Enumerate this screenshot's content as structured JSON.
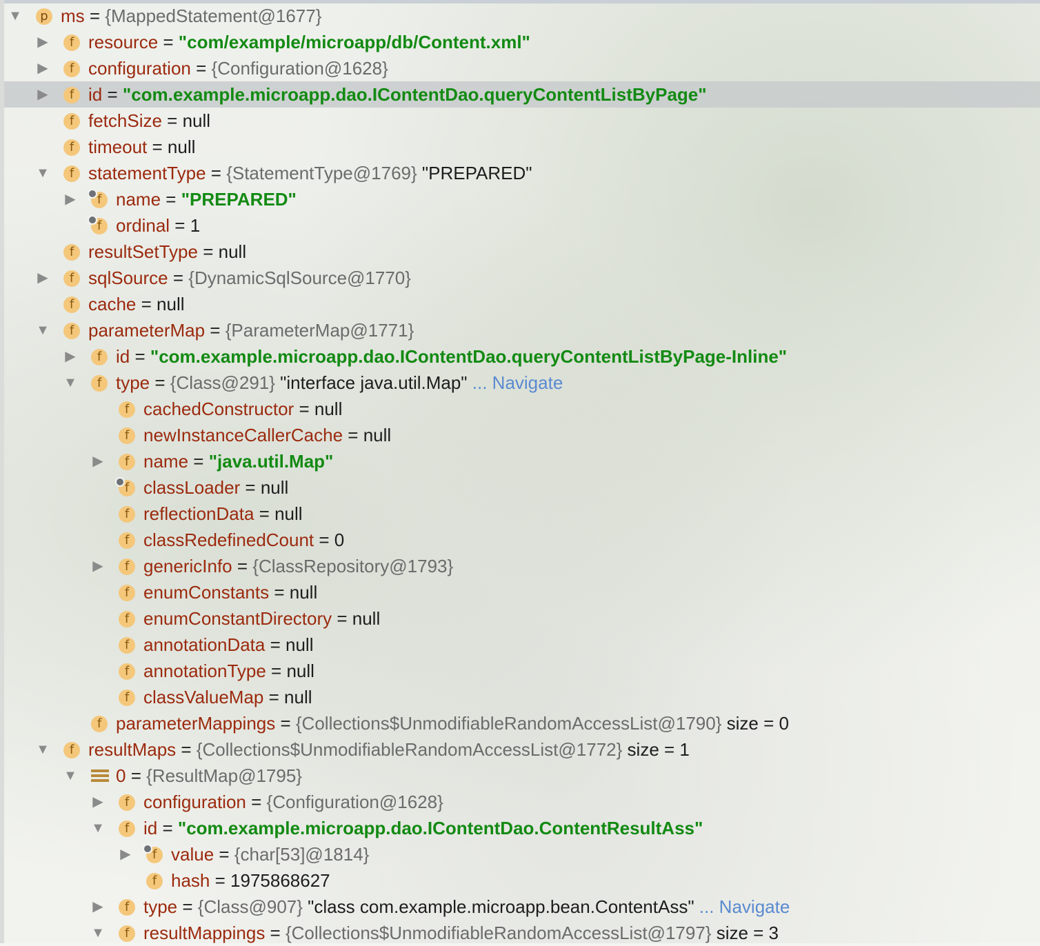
{
  "rows": [
    {
      "depth": 0,
      "arrow": "down",
      "icon": "p",
      "name": "ms",
      "eq": " = ",
      "ref": "{MappedStatement@1677}"
    },
    {
      "depth": 1,
      "arrow": "right",
      "icon": "f",
      "name": "resource",
      "eq": " = ",
      "str": "\"com/example/microapp/db/Content.xml\""
    },
    {
      "depth": 1,
      "arrow": "right",
      "icon": "f",
      "name": "configuration",
      "eq": " = ",
      "ref": "{Configuration@1628}"
    },
    {
      "depth": 1,
      "arrow": "right",
      "icon": "f",
      "name": "id",
      "eq": " = ",
      "str": "\"com.example.microapp.dao.IContentDao.queryContentListByPage\"",
      "selected": true
    },
    {
      "depth": 1,
      "arrow": "none",
      "icon": "f",
      "name": "fetchSize",
      "eq": " = ",
      "plain": "null"
    },
    {
      "depth": 1,
      "arrow": "none",
      "icon": "f",
      "name": "timeout",
      "eq": " = ",
      "plain": "null"
    },
    {
      "depth": 1,
      "arrow": "down",
      "icon": "f",
      "name": "statementType",
      "eq": " = ",
      "ref": "{StatementType@1769}",
      "plain": " \"PREPARED\""
    },
    {
      "depth": 2,
      "arrow": "right",
      "icon": "f-pin",
      "name": "name",
      "eq": " = ",
      "str": "\"PREPARED\""
    },
    {
      "depth": 2,
      "arrow": "none",
      "icon": "f-pin",
      "name": "ordinal",
      "eq": " = ",
      "plain": "1"
    },
    {
      "depth": 1,
      "arrow": "none",
      "icon": "f",
      "name": "resultSetType",
      "eq": " = ",
      "plain": "null"
    },
    {
      "depth": 1,
      "arrow": "right",
      "icon": "f",
      "name": "sqlSource",
      "eq": " = ",
      "ref": "{DynamicSqlSource@1770}"
    },
    {
      "depth": 1,
      "arrow": "none",
      "icon": "f",
      "name": "cache",
      "eq": " = ",
      "plain": "null"
    },
    {
      "depth": 1,
      "arrow": "down",
      "icon": "f",
      "name": "parameterMap",
      "eq": " = ",
      "ref": "{ParameterMap@1771}"
    },
    {
      "depth": 2,
      "arrow": "right",
      "icon": "f",
      "name": "id",
      "eq": " = ",
      "str": "\"com.example.microapp.dao.IContentDao.queryContentListByPage-Inline\""
    },
    {
      "depth": 2,
      "arrow": "down",
      "icon": "f",
      "name": "type",
      "eq": " = ",
      "ref": "{Class@291}",
      "plain": " \"interface java.util.Map\"",
      "nav": " ... Navigate"
    },
    {
      "depth": 3,
      "arrow": "none",
      "icon": "f",
      "name": "cachedConstructor",
      "eq": " = ",
      "plain": "null"
    },
    {
      "depth": 3,
      "arrow": "none",
      "icon": "f",
      "name": "newInstanceCallerCache",
      "eq": " = ",
      "plain": "null"
    },
    {
      "depth": 3,
      "arrow": "right",
      "icon": "f",
      "name": "name",
      "eq": " = ",
      "str": "\"java.util.Map\""
    },
    {
      "depth": 3,
      "arrow": "none",
      "icon": "f-pin",
      "name": "classLoader",
      "eq": " = ",
      "plain": "null"
    },
    {
      "depth": 3,
      "arrow": "none",
      "icon": "f",
      "name": "reflectionData",
      "eq": " = ",
      "plain": "null"
    },
    {
      "depth": 3,
      "arrow": "none",
      "icon": "f",
      "name": "classRedefinedCount",
      "eq": " = ",
      "plain": "0"
    },
    {
      "depth": 3,
      "arrow": "right",
      "icon": "f",
      "name": "genericInfo",
      "eq": " = ",
      "ref": "{ClassRepository@1793}"
    },
    {
      "depth": 3,
      "arrow": "none",
      "icon": "f",
      "name": "enumConstants",
      "eq": " = ",
      "plain": "null"
    },
    {
      "depth": 3,
      "arrow": "none",
      "icon": "f",
      "name": "enumConstantDirectory",
      "eq": " = ",
      "plain": "null"
    },
    {
      "depth": 3,
      "arrow": "none",
      "icon": "f",
      "name": "annotationData",
      "eq": " = ",
      "plain": "null"
    },
    {
      "depth": 3,
      "arrow": "none",
      "icon": "f",
      "name": "annotationType",
      "eq": " = ",
      "plain": "null"
    },
    {
      "depth": 3,
      "arrow": "none",
      "icon": "f",
      "name": "classValueMap",
      "eq": " = ",
      "plain": "null"
    },
    {
      "depth": 2,
      "arrow": "none",
      "icon": "f",
      "name": "parameterMappings",
      "eq": " = ",
      "ref": "{Collections$UnmodifiableRandomAccessList@1790}",
      "plain": "  size = 0"
    },
    {
      "depth": 1,
      "arrow": "down",
      "icon": "f",
      "name": "resultMaps",
      "eq": " = ",
      "ref": "{Collections$UnmodifiableRandomAccessList@1772}",
      "plain": "  size = 1"
    },
    {
      "depth": 2,
      "arrow": "down",
      "icon": "arr",
      "name": "0",
      "eq": " = ",
      "ref": "{ResultMap@1795}"
    },
    {
      "depth": 3,
      "arrow": "right",
      "icon": "f",
      "name": "configuration",
      "eq": " = ",
      "ref": "{Configuration@1628}"
    },
    {
      "depth": 3,
      "arrow": "down",
      "icon": "f",
      "name": "id",
      "eq": " = ",
      "str": "\"com.example.microapp.dao.IContentDao.ContentResultAss\""
    },
    {
      "depth": 4,
      "arrow": "right",
      "icon": "f-pin",
      "name": "value",
      "eq": " = ",
      "ref": "{char[53]@1814}"
    },
    {
      "depth": 4,
      "arrow": "none",
      "icon": "f",
      "name": "hash",
      "eq": " = ",
      "plain": "1975868627"
    },
    {
      "depth": 3,
      "arrow": "right",
      "icon": "f",
      "name": "type",
      "eq": " = ",
      "ref": "{Class@907}",
      "plain": " \"class com.example.microapp.bean.ContentAss\"",
      "nav": " ... Navigate"
    },
    {
      "depth": 3,
      "arrow": "down",
      "icon": "f",
      "name": "resultMappings",
      "eq": " = ",
      "ref": "{Collections$UnmodifiableRandomAccessList@1797}",
      "plain": "  size = 3"
    }
  ],
  "glyphs": {
    "right": "▶",
    "down": "▼",
    "p": "p",
    "f": "f"
  }
}
